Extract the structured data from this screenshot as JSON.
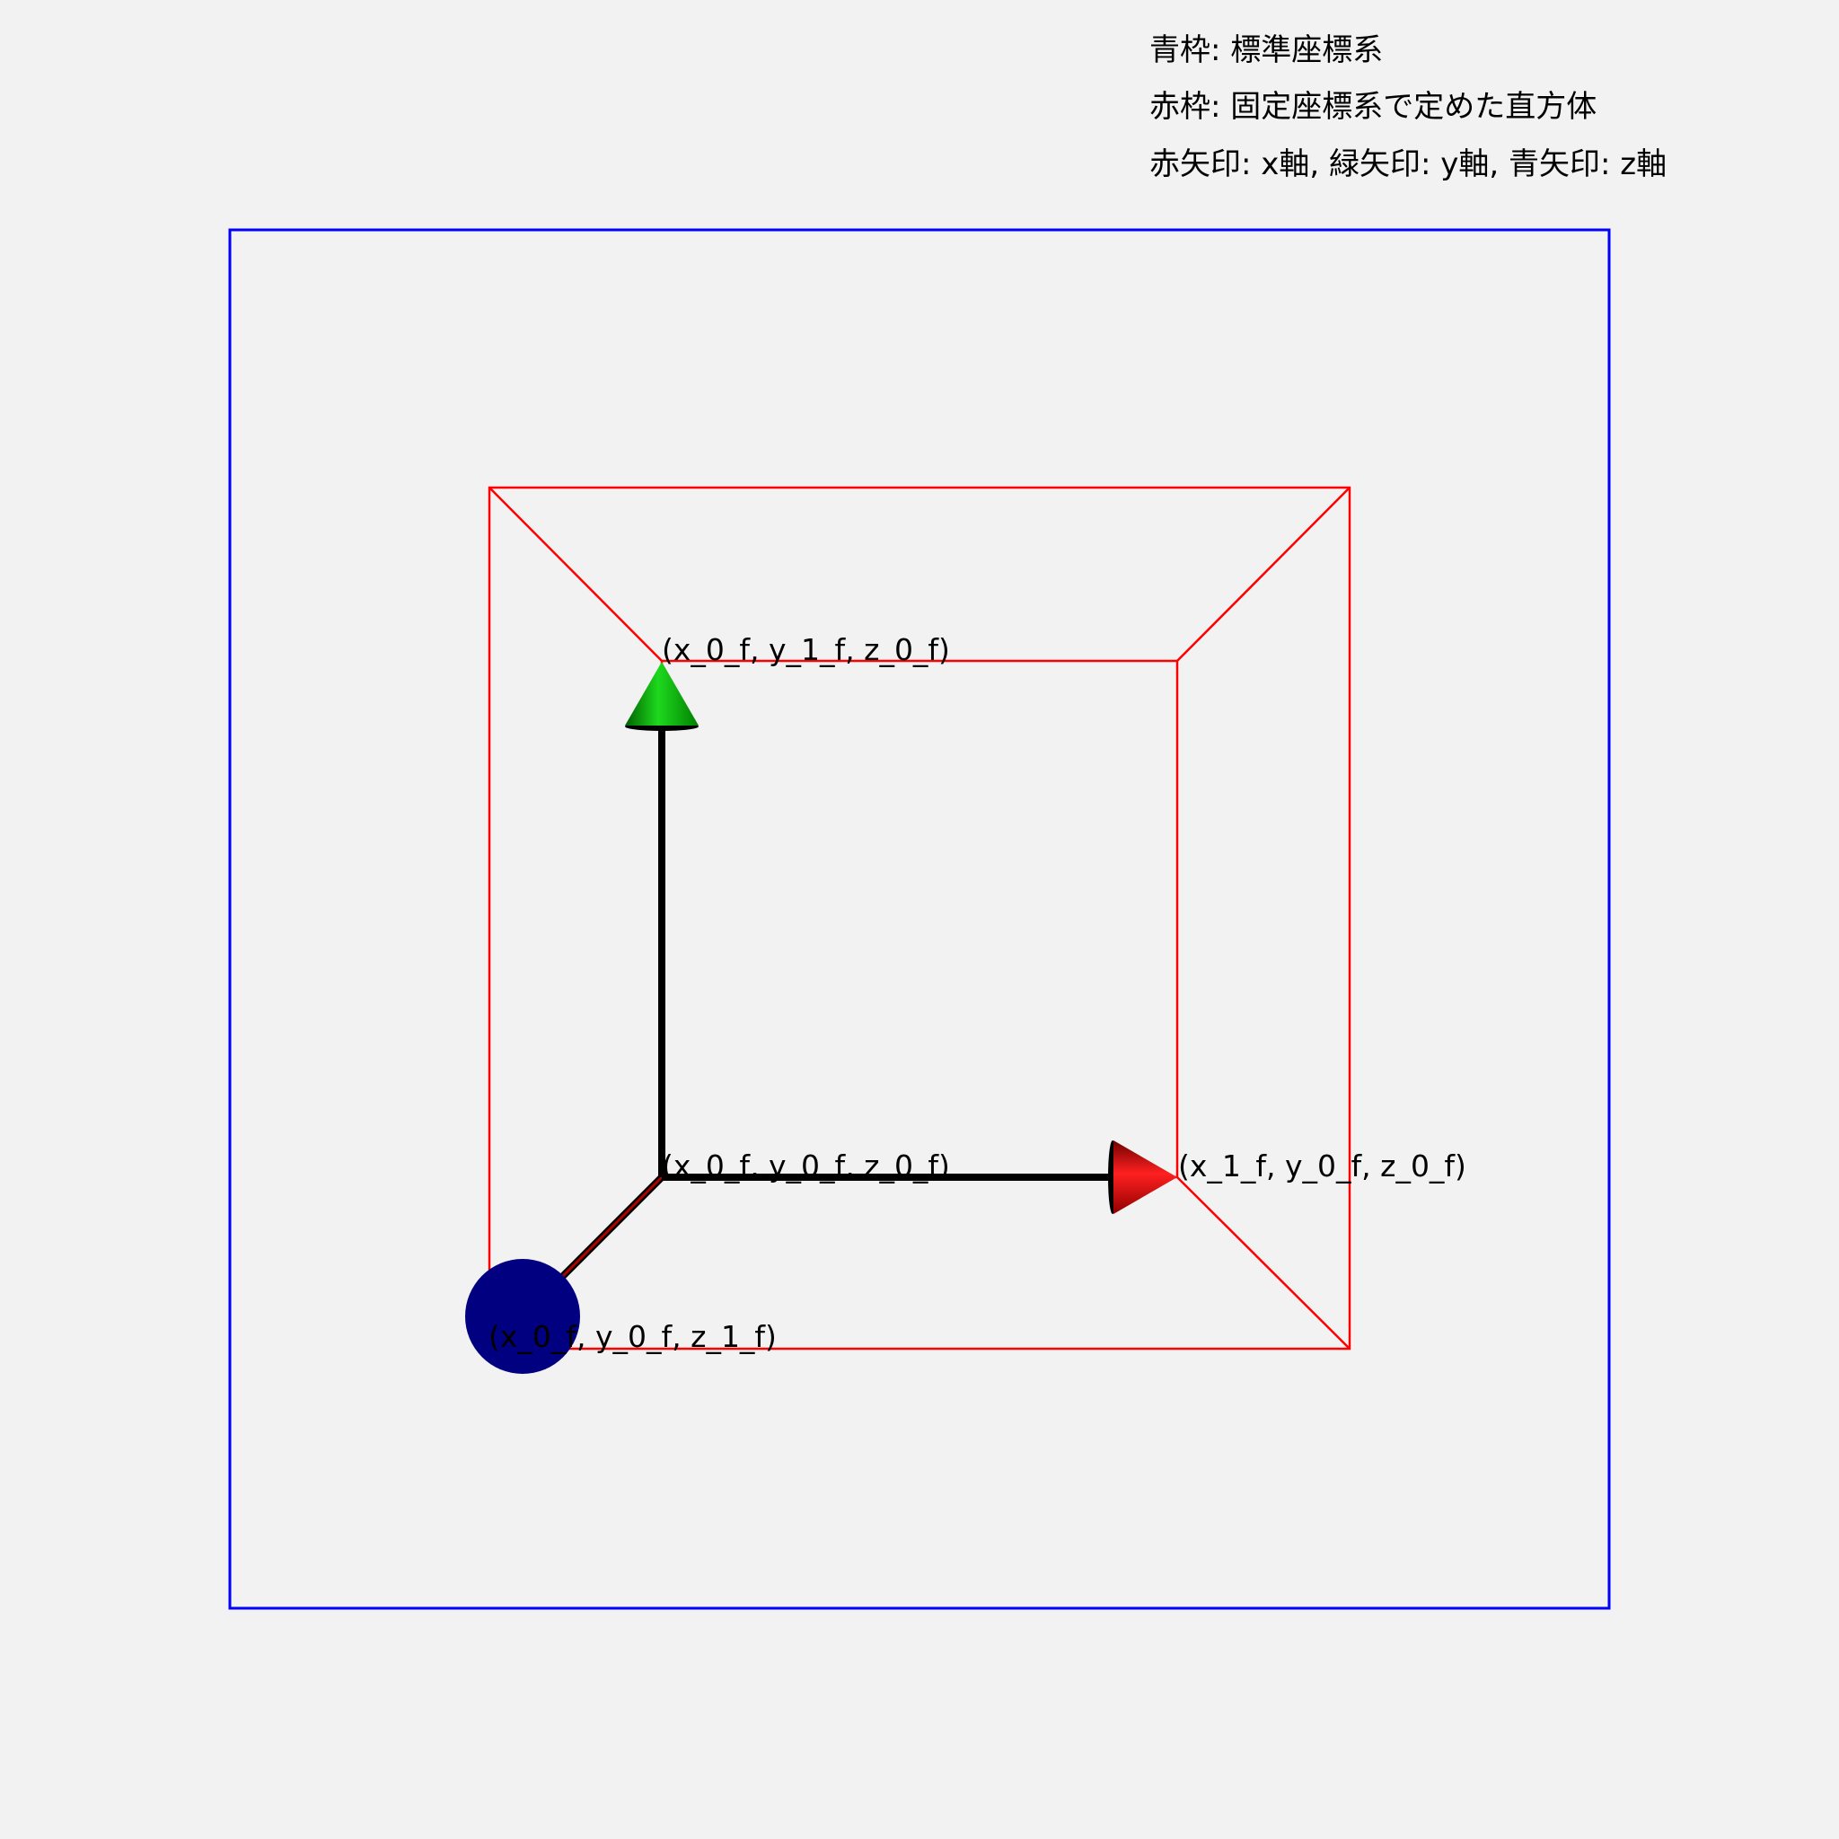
{
  "legend": {
    "line1": "青枠: 標準座標系",
    "line2": "赤枠: 固定座標系で定めた直方体",
    "line3": "赤矢印: x軸, 緑矢印: y軸, 青矢印: z軸"
  },
  "points": {
    "origin": "(x_0_f, y_0_f, z_0_f)",
    "x_tip": "(x_1_f, y_0_f, z_0_f)",
    "y_tip": "(x_0_f, y_1_f, z_0_f)",
    "z_tip": "(x_0_f, y_0_f, z_1_f)"
  },
  "colors": {
    "background": "#f2f2f2",
    "standard_frame": "#0000ff",
    "fixed_box": "#ff0000",
    "x_arrow": "#e00000",
    "y_arrow": "#00c000",
    "z_arrow": "#000080",
    "shaft": "#000000"
  }
}
